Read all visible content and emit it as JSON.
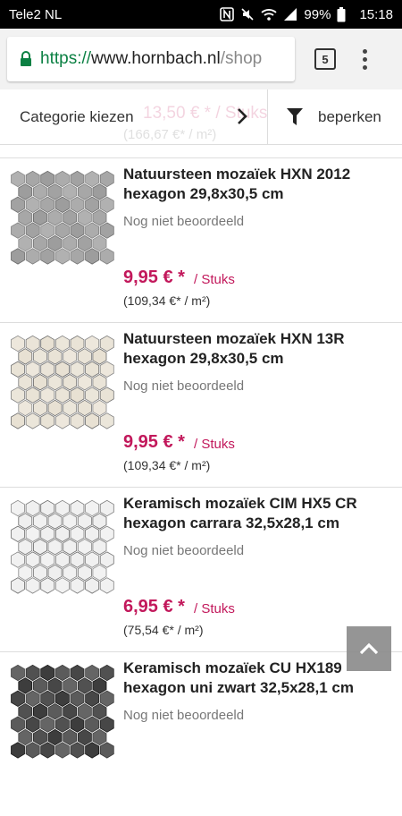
{
  "status": {
    "carrier": "Tele2 NL",
    "battery": "99%",
    "time": "15:18"
  },
  "browser": {
    "url_scheme": "https://",
    "url_host": "www.hornbach.nl",
    "url_path": "/shop",
    "tab_count": "5"
  },
  "filters": {
    "category_label": "Categorie kiezen",
    "filter_label": "beperken",
    "ghost_price": "13,50 € *  / Stuks",
    "ghost_sub": "(166,67 €*  / m²)"
  },
  "products": [
    {
      "name": "Natuursteen mozaïek HXN 2012 hexagon 29,8x30,5 cm",
      "rating": "Nog niet beoordeeld",
      "price": "9,95 € *",
      "unit": "/ Stuks",
      "per_m2": "(109,34 €*  / m²)",
      "tile_color": "#9c9c9c"
    },
    {
      "name": "Natuursteen mozaïek HXN 13R hexagon 29,8x30,5 cm",
      "rating": "Nog niet beoordeeld",
      "price": "9,95 € *",
      "unit": "/ Stuks",
      "per_m2": "(109,34 €*  / m²)",
      "tile_color": "#e8e1d3"
    },
    {
      "name": "Keramisch mozaïek CIM HX5 CR hexagon carrara 32,5x28,1 cm",
      "rating": "Nog niet beoordeeld",
      "price": "6,95 € *",
      "unit": "/ Stuks",
      "per_m2": "(75,54 €*  / m²)",
      "tile_color": "#efefef"
    },
    {
      "name": "Keramisch mozaïek CU HX189 hexagon uni zwart 32,5x28,1 cm",
      "rating": "Nog niet beoordeeld",
      "price": "",
      "unit": "",
      "per_m2": "",
      "tile_color": "#3a3a3a"
    }
  ],
  "colors": {
    "accent": "#c2185b",
    "secure": "#0b8043"
  },
  "icons": [
    "lock-icon",
    "chevron-right-icon",
    "filter-funnel-icon",
    "arrow-up-icon"
  ]
}
